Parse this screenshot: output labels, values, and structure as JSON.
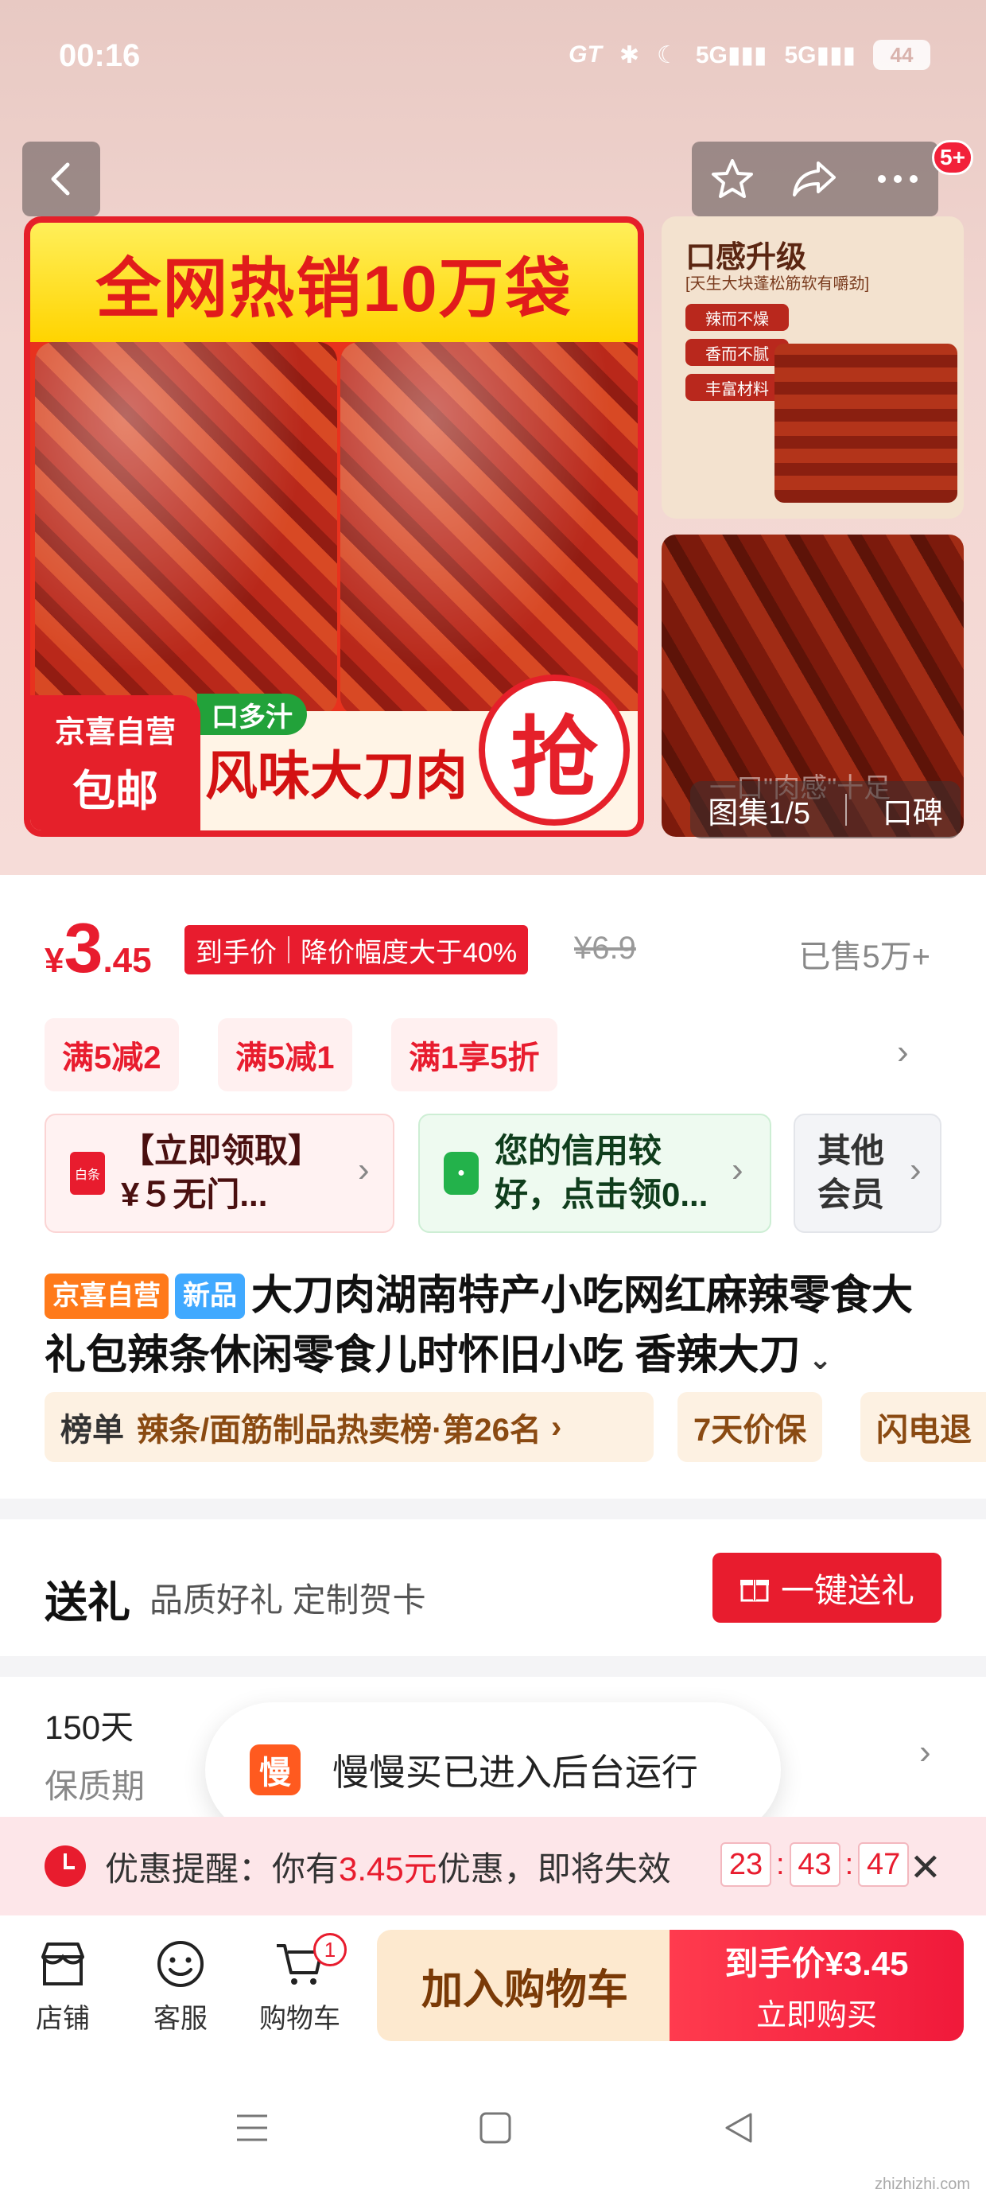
{
  "status_bar": {
    "time": "00:16",
    "network": "GT",
    "signal1": "5G",
    "signal2": "5G",
    "battery": "44"
  },
  "gallery": {
    "badge_count": "5+",
    "main_image": {
      "banner": "全网热销10万袋",
      "tag_line1": "京喜自营",
      "tag_line2": "包邮",
      "green_label": "口多汁",
      "product_name": "风味大刀肉",
      "grab_label": "抢"
    },
    "side_image_1": {
      "title": "口感升级",
      "subtitle": "[天生大块蓬松筋软有嚼劲]",
      "pills": [
        "辣而不燥",
        "香而不腻",
        "丰富材料"
      ]
    },
    "side_image_2": {
      "text": "一口\"肉感\"十足"
    },
    "counter_label": "图集1/5",
    "reviews_label": "口碑"
  },
  "price": {
    "currency": "¥",
    "integer": "3",
    "decimal": ".45",
    "arrival_label": "到手价",
    "drop_label": "降价幅度大于40%",
    "original": "¥6.9",
    "sold": "已售5万+"
  },
  "promos": [
    "满5减2",
    "满5减1",
    "满1享5折"
  ],
  "coupons": [
    {
      "text": "【立即领取】¥５无门...",
      "icon": "coupon-icon"
    },
    {
      "text": "您的信用较好，点击领0...",
      "icon": "shopping-bag-icon"
    },
    {
      "text": "其他会员",
      "icon": ""
    }
  ],
  "product": {
    "badge_self": "京喜自营",
    "badge_new": "新品",
    "title": "大刀肉湖南特产小吃网红麻辣零食大礼包辣条休闲零食儿时怀旧小吃 香辣大刀"
  },
  "rank_chips": [
    {
      "prefix": "榜单",
      "text": "辣条/面筋制品热卖榜·第26名"
    },
    {
      "prefix": "",
      "text": "7天价保"
    },
    {
      "prefix": "",
      "text": "闪电退"
    }
  ],
  "gift": {
    "title": "送礼",
    "subtitle": "品质好礼 定制贺卡",
    "button": "一键送礼"
  },
  "shelf_life": {
    "value": "150天",
    "label": "保质期"
  },
  "toast": {
    "icon_text": "慢",
    "message": "慢慢买已进入后台运行"
  },
  "reminder": {
    "prefix": "优惠提醒：你有",
    "amount": "3.45元",
    "suffix": "优惠，即将失效",
    "hours": "23",
    "minutes": "43",
    "seconds": "47"
  },
  "bottom_nav": {
    "store": "店铺",
    "service": "客服",
    "cart": "购物车",
    "cart_count": "1",
    "add_to_cart": "加入购物车",
    "buy_line1": "到手价¥3.45",
    "buy_line2": "立即购买"
  },
  "watermark": "zhizhizhi.com",
  "colors": {
    "accent": "#e81c2e",
    "orange": "#ff7a1a",
    "blue": "#40a9ff",
    "green": "#22a23a"
  }
}
